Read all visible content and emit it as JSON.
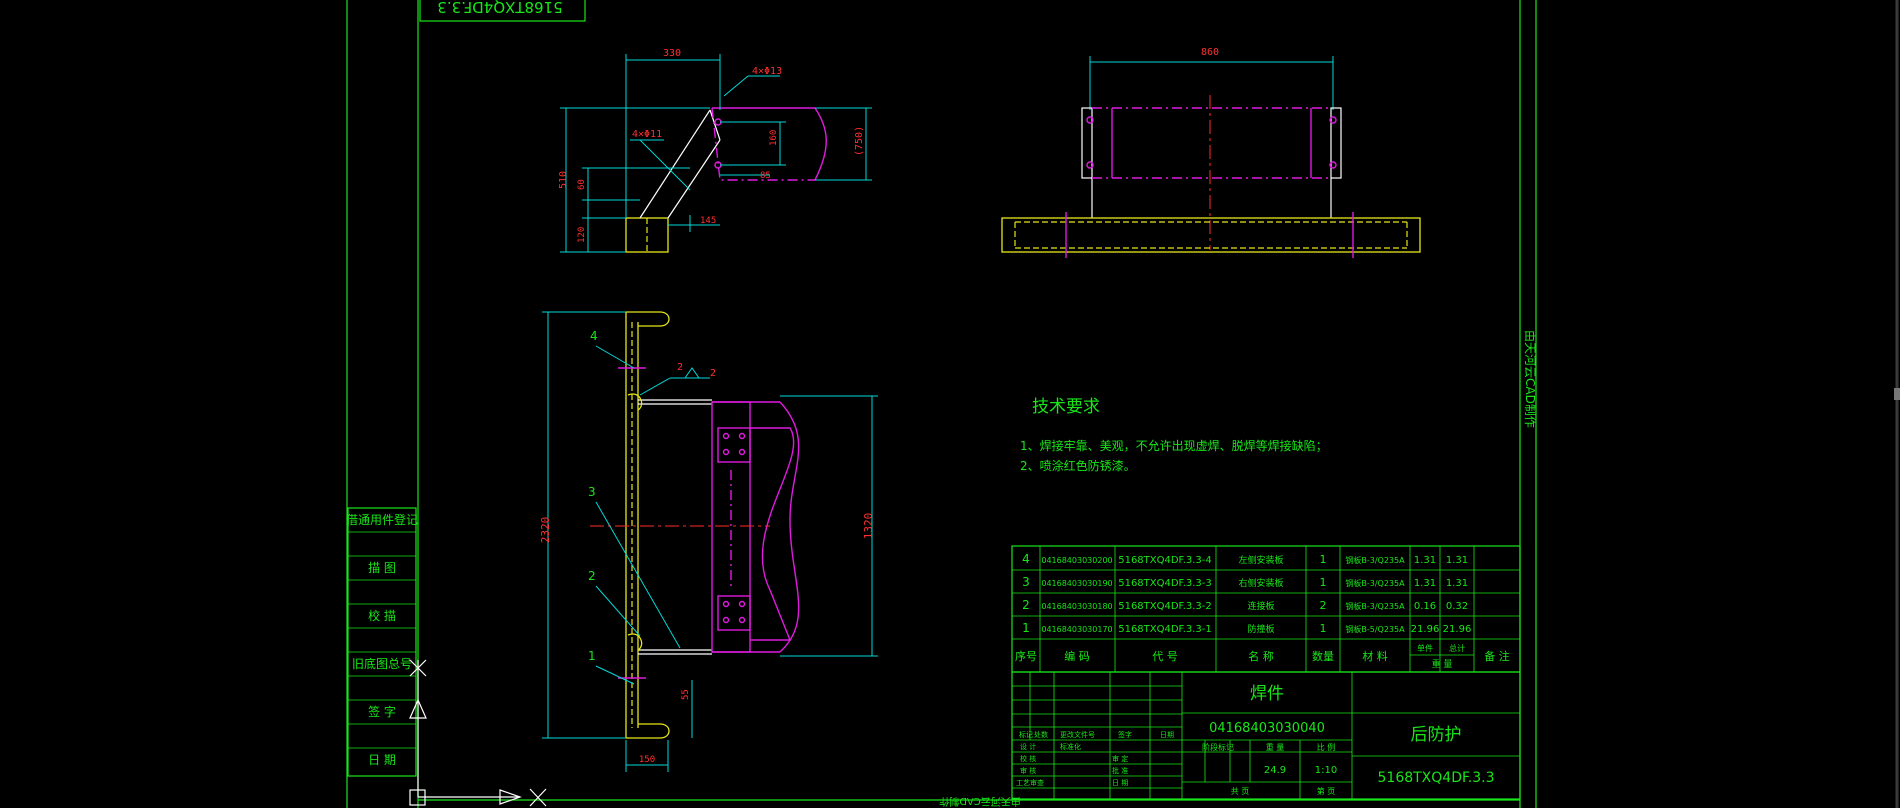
{
  "titleblock": {
    "part_name": "焊件",
    "drawing_code": "04168403030040",
    "product_name": "后防护",
    "drawing_number": "5168TXQ4DF.3.3",
    "weight": "24.9",
    "scale": "1:10",
    "sheets_total_label": "共 页",
    "sheet_label": "第 页",
    "header_labels": [
      "阶段标记",
      "重 量",
      "比 例"
    ],
    "sign_rows": [
      "标记",
      "处数",
      "更改文件号",
      "签字",
      "日期"
    ],
    "role_rows": [
      "设 计",
      "标准化",
      "校 核",
      "审 定",
      "审 核",
      "批 准",
      "工艺审查",
      "日 期"
    ]
  },
  "top_stamp": "5168TXQ4DF.3.3",
  "left_strip": [
    "借通用件登记",
    "描 图",
    "校 描",
    "旧底图总号",
    "签 字",
    "日 期"
  ],
  "right_note": "由天河云CAD制作",
  "bottom_note": "由天河云CAD制作",
  "tech_requirements": {
    "title": "技术要求",
    "items": [
      "1、焊接牢靠、美观，不允许出现虚焊、脱焊等焊接缺陷；",
      "2、喷涂红色防锈漆。"
    ]
  },
  "bom": {
    "headers": [
      "序号",
      "编  码",
      "代  号",
      "名  称",
      "数量",
      "材  料",
      "单件",
      "总计",
      "重 量",
      "备 注"
    ],
    "rows": [
      {
        "no": "4",
        "code": "04168403030200",
        "drawing": "5168TXQ4DF.3.3-4",
        "name": "左侧安装板",
        "qty": "1",
        "material": "钢板B-3/Q235A",
        "unit": "1.31",
        "total": "1.31"
      },
      {
        "no": "3",
        "code": "04168403030190",
        "drawing": "5168TXQ4DF.3.3-3",
        "name": "右侧安装板",
        "qty": "1",
        "material": "钢板B-3/Q235A",
        "unit": "1.31",
        "total": "1.31"
      },
      {
        "no": "2",
        "code": "04168403030180",
        "drawing": "5168TXQ4DF.3.3-2",
        "name": "连接板",
        "qty": "2",
        "material": "钢板B-3/Q235A",
        "unit": "0.16",
        "total": "0.32"
      },
      {
        "no": "1",
        "code": "04168403030170",
        "drawing": "5168TXQ4DF.3.3-1",
        "name": "防撞板",
        "qty": "1",
        "material": "钢板B-5/Q235A",
        "unit": "21.96",
        "total": "21.96"
      }
    ]
  },
  "dimensions": {
    "d330": "330",
    "d4x13": "4×Φ13",
    "d4x11": "4×Φ11",
    "d510": "510",
    "d160": "160",
    "d750": "(750)",
    "d60": "60",
    "d85": "85",
    "d120": "120",
    "d145": "145",
    "d860": "860",
    "d2320": "2320",
    "d1320": "1320",
    "d55": "55",
    "d150": "150",
    "weld": "2"
  },
  "balloons": [
    "4",
    "3",
    "2",
    "1"
  ]
}
